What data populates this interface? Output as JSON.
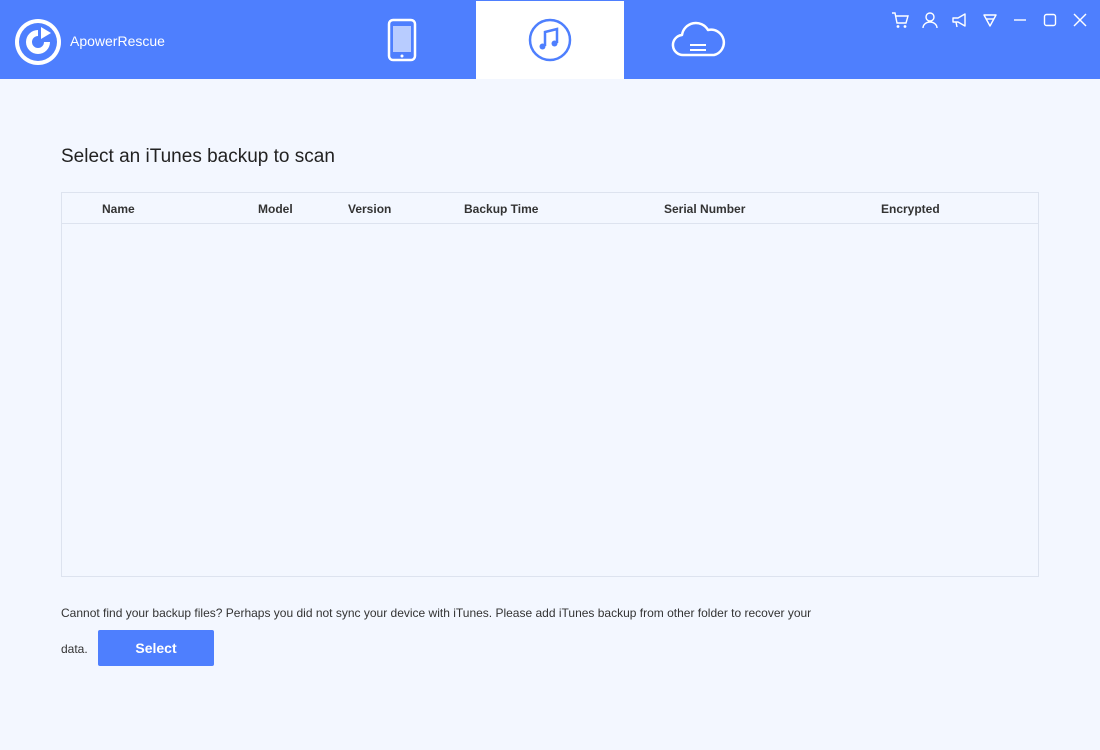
{
  "app": {
    "name": "ApowerRescue"
  },
  "tabs": [
    {
      "icon": "phone-icon",
      "active": false
    },
    {
      "icon": "music-note-icon",
      "active": true
    },
    {
      "icon": "cloud-icon",
      "active": false
    }
  ],
  "window_controls": [
    "cart-icon",
    "user-icon",
    "megaphone-icon",
    "menu-triangle-icon",
    "minimize-icon",
    "maximize-icon",
    "close-icon"
  ],
  "main": {
    "heading": "Select an iTunes backup to scan",
    "table": {
      "columns": [
        "Name",
        "Model",
        "Version",
        "Backup Time",
        "Serial Number",
        "Encrypted"
      ],
      "rows": []
    },
    "hint_line1": "Cannot find your backup files? Perhaps you did not sync your device with iTunes. Please add iTunes backup from other folder to recover your",
    "hint_line2": "data.",
    "select_label": "Select"
  },
  "colors": {
    "accent": "#4e7ffe",
    "background": "#f3f7ff",
    "border": "#dde3ef"
  }
}
